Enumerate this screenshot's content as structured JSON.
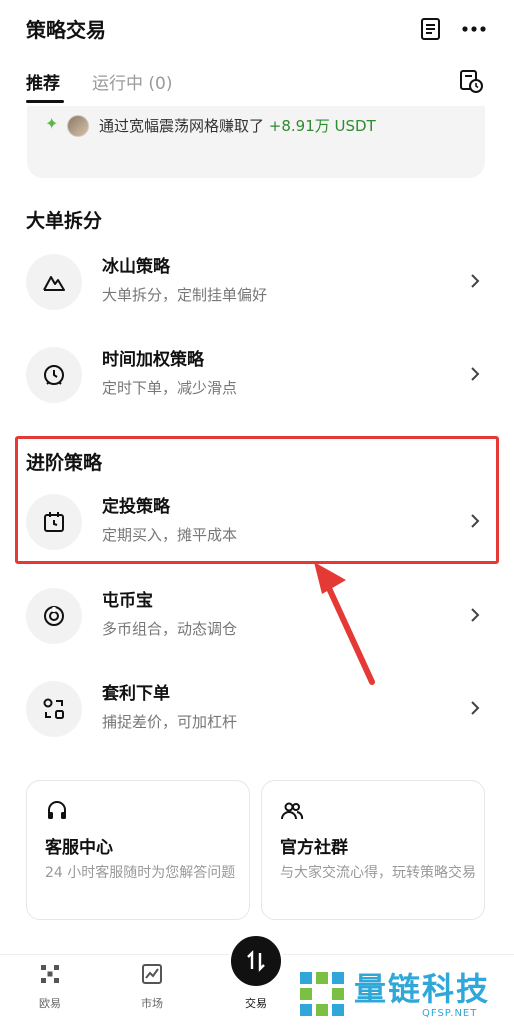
{
  "header": {
    "title": "策略交易",
    "doc_icon": "document-icon",
    "more_icon": "more-icon"
  },
  "tabs": [
    {
      "label": "推荐",
      "active": true
    },
    {
      "label": "运行中 (0)",
      "active": false
    }
  ],
  "banner": {
    "prefix": "通过宽幅震荡网格赚取了 ",
    "gain": "+8.91万 USDT"
  },
  "sections": [
    {
      "title": "大单拆分",
      "items": [
        {
          "name": "冰山策略",
          "desc": "大单拆分，定制挂单偏好",
          "icon": "mountain-icon"
        },
        {
          "name": "时间加权策略",
          "desc": "定时下单，减少滑点",
          "icon": "clock-icon"
        }
      ]
    },
    {
      "title": "进阶策略",
      "items": [
        {
          "name": "定投策略",
          "desc": "定期买入，摊平成本",
          "icon": "calendar-icon"
        },
        {
          "name": "屯币宝",
          "desc": "多币组合，动态调仓",
          "icon": "coin-target-icon"
        },
        {
          "name": "套利下单",
          "desc": "捕捉差价，可加杠杆",
          "icon": "arbitrage-icon"
        }
      ]
    }
  ],
  "cards": [
    {
      "title": "客服中心",
      "desc": "24 小时客服随时为您解答问题",
      "icon": "headset-icon"
    },
    {
      "title": "官方社群",
      "desc": "与大家交流心得，玩转策略交易",
      "icon": "community-icon"
    }
  ],
  "nav": [
    {
      "label": "欧易",
      "icon": "okx-logo-icon"
    },
    {
      "label": "市场",
      "icon": "market-chart-icon"
    },
    {
      "label": "交易",
      "icon": "trade-swap-icon"
    }
  ],
  "watermark": {
    "text": "量链科技",
    "sub": "QFSP.NET"
  },
  "colors": {
    "highlight": "#e53935",
    "gain": "#2e8b2e",
    "watermark": "#2fa7d8"
  }
}
